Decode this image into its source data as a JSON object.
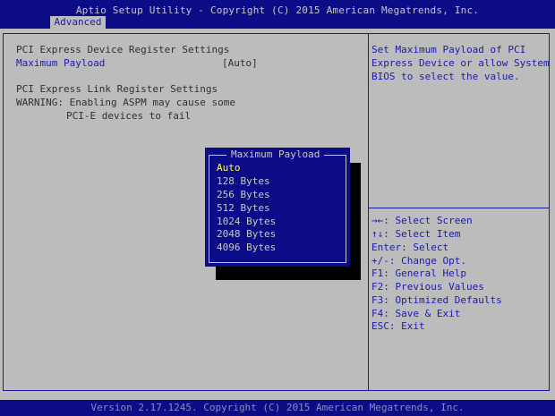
{
  "header": {
    "title": "Aptio Setup Utility - Copyright (C) 2015 American Megatrends, Inc.",
    "active_tab": "Advanced"
  },
  "main": {
    "section1_title": "PCI Express Device Register Settings",
    "max_payload_label": "Maximum Payload",
    "max_payload_value": "[Auto]",
    "section2_title": "PCI Express Link Register Settings",
    "warning_line1": "WARNING: Enabling ASPM may cause some",
    "warning_line2": "PCI-E devices to fail"
  },
  "help": {
    "line1": "Set Maximum Payload of PCI",
    "line2": "Express Device or allow System",
    "line3": "BIOS to select the value."
  },
  "keys": [
    "→←: Select Screen",
    "↑↓: Select Item",
    "Enter: Select",
    "+/-: Change Opt.",
    "F1: General Help",
    "F2: Previous Values",
    "F3: Optimized Defaults",
    "F4: Save & Exit",
    "ESC: Exit"
  ],
  "popup": {
    "title": "Maximum Payload",
    "options": [
      "Auto",
      "128 Bytes",
      "256 Bytes",
      "512 Bytes",
      "1024 Bytes",
      "2048 Bytes",
      "4096 Bytes"
    ],
    "selected": "Auto"
  },
  "footer": {
    "text": "Version 2.17.1245. Copyright (C) 2015 American Megatrends, Inc."
  },
  "colors": {
    "bar_blue": "#0c0c86",
    "panel_gray": "#bcbcbc",
    "highlight_yellow": "#ffff54"
  }
}
